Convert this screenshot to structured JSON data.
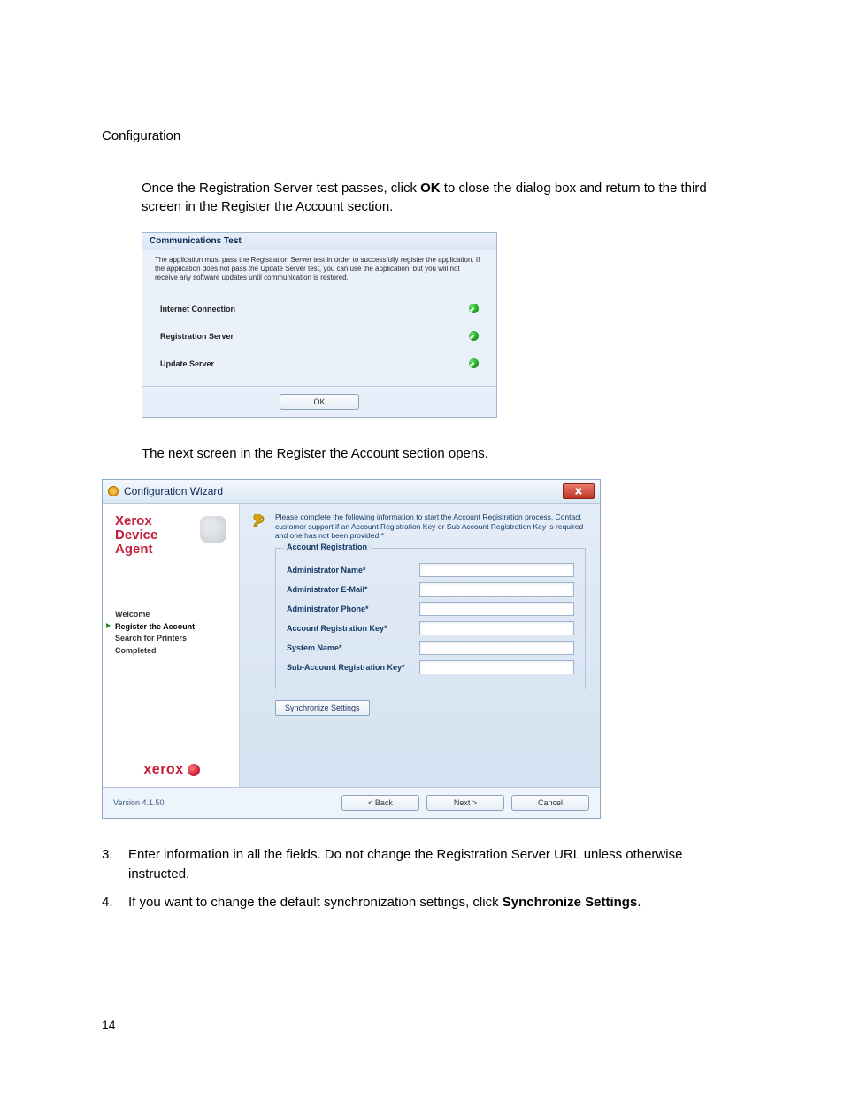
{
  "header": "Configuration",
  "para1_a": "Once the Registration Server test passes, click ",
  "para1_b": "OK",
  "para1_c": " to close the dialog box and return to the third screen in the Register the Account section.",
  "comm": {
    "title": "Communications Test",
    "desc": "The application must pass the Registration Server test in order to successfully register the application. If the application does not pass the Update Server test, you can use the application, but you will not receive any software updates until communication is restored.",
    "rows": [
      "Internet Connection",
      "Registration Server",
      "Update Server"
    ],
    "ok": "OK"
  },
  "para2": "The next screen in the Register the Account section opens.",
  "wizard": {
    "title": "Configuration Wizard",
    "logo_l1": "Xerox",
    "logo_l2": "Device",
    "logo_l3": "Agent",
    "steps": [
      "Welcome",
      "Register the Account",
      "Search for Printers",
      "Completed"
    ],
    "current_step_index": 1,
    "brand": "xerox",
    "instr": "Please complete the following information to start the Account Registration process. Contact customer support if an Account Registration Key or Sub Account Registration Key is required and one has not been provided.*",
    "group_title": "Account Registration",
    "fields": [
      "Administrator Name*",
      "Administrator E-Mail*",
      "Administrator Phone*",
      "Account Registration Key*",
      "System Name*",
      "Sub-Account Registration Key*"
    ],
    "sync": "Synchronize Settings",
    "version": "Version 4.1.50",
    "back": "< Back",
    "next": "Next >",
    "cancel": "Cancel"
  },
  "step3_a": "Enter information in all the fields. Do not change the Registration Server URL unless otherwise instructed.",
  "step4_a": "If you want to change the default synchronization settings, click ",
  "step4_b": "Synchronize Settings",
  "step4_c": ".",
  "pagenum": "14"
}
